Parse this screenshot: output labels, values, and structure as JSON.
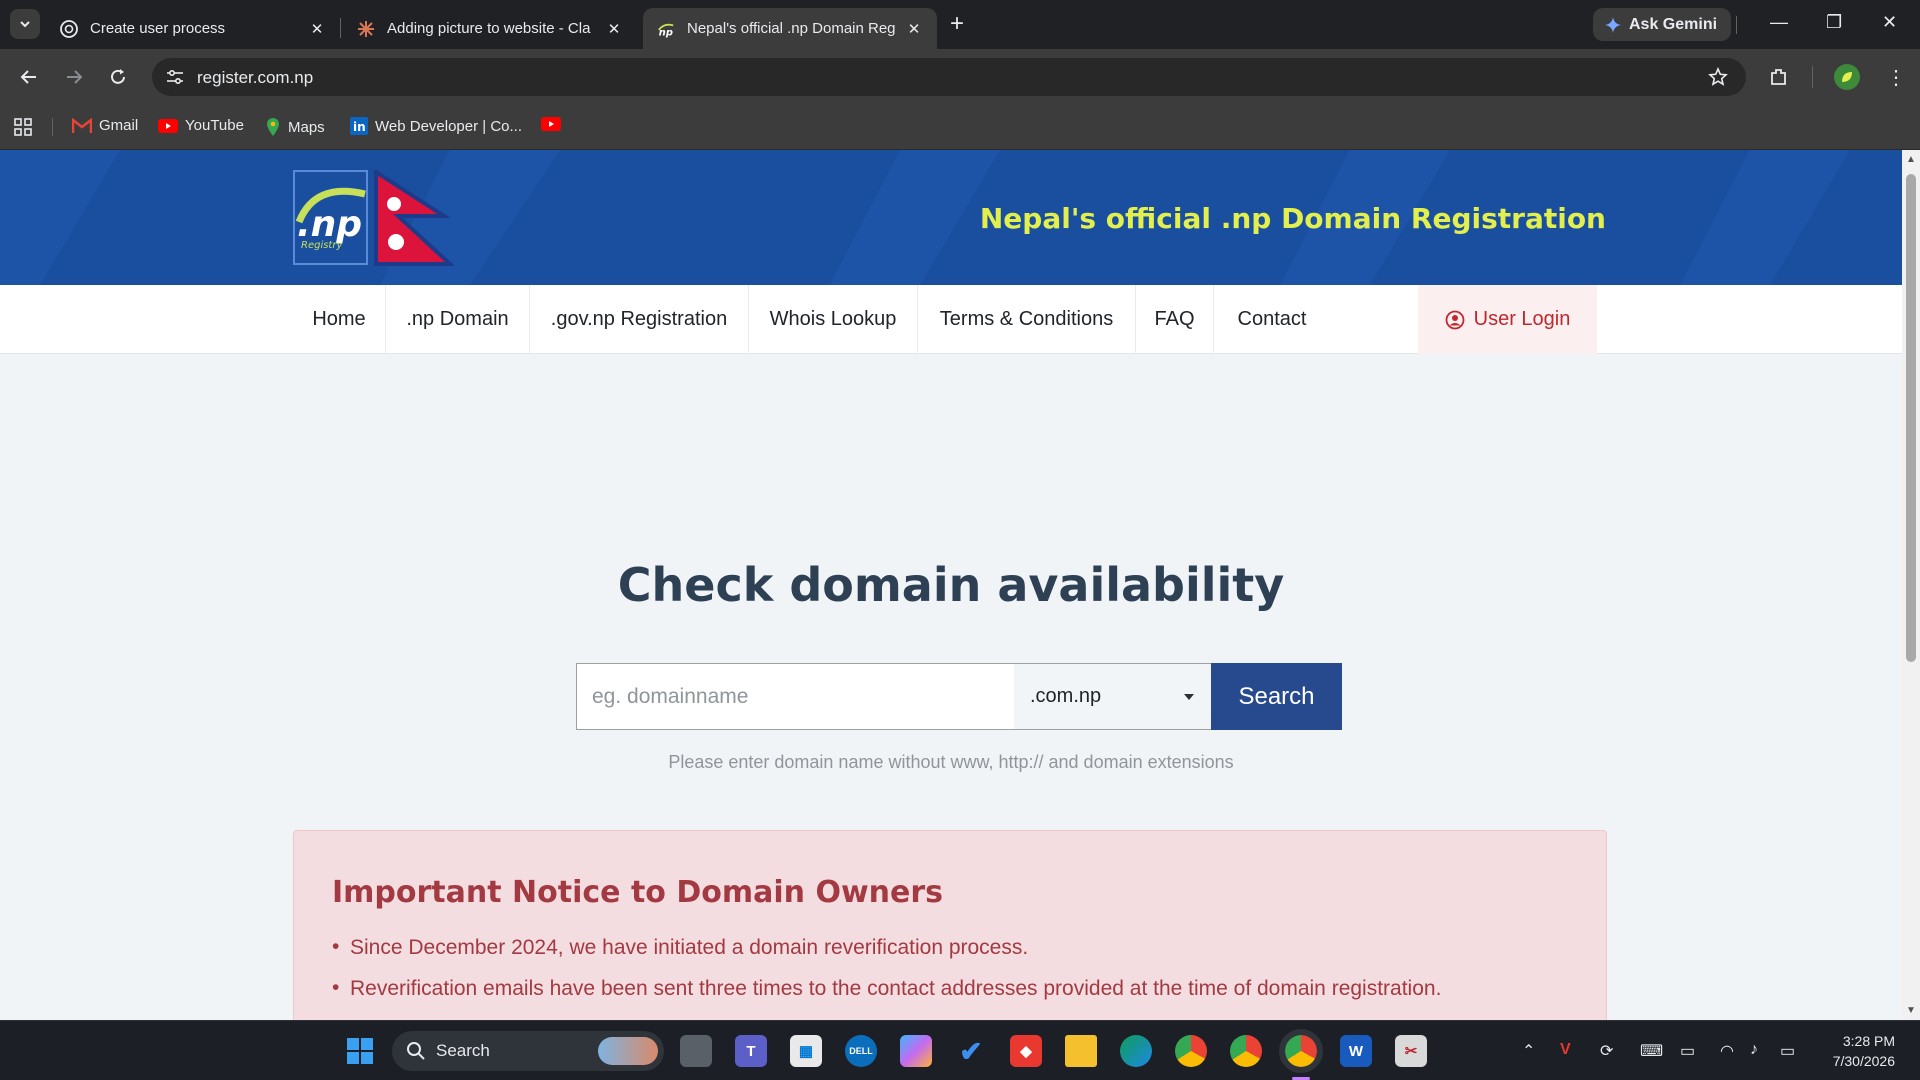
{
  "browser": {
    "tabs": [
      {
        "title": "Create user process",
        "icon": "openai-icon",
        "active": false
      },
      {
        "title": "Adding picture to website - Cla",
        "icon": "claude-icon",
        "active": false
      },
      {
        "title": "Nepal's official .np Domain Reg",
        "icon": "np-registry-icon",
        "active": true
      }
    ],
    "ask_gemini_label": "Ask Gemini",
    "url": "register.com.np",
    "bookmarks": [
      {
        "label": "Gmail",
        "icon": "gmail-icon"
      },
      {
        "label": "YouTube",
        "icon": "youtube-icon"
      },
      {
        "label": "Maps",
        "icon": "maps-icon"
      },
      {
        "label": "Web Developer | Co...",
        "icon": "linkedin-icon"
      },
      {
        "label": "",
        "icon": "youtube-icon"
      }
    ]
  },
  "site": {
    "logo_text": ".np",
    "logo_sub": "Registry",
    "tagline": "Nepal's official .np Domain Registration",
    "nav": [
      {
        "label": "Home"
      },
      {
        "label": ".np Domain"
      },
      {
        "label": ".gov.np Registration"
      },
      {
        "label": "Whois Lookup"
      },
      {
        "label": "Terms & Conditions"
      },
      {
        "label": "FAQ"
      },
      {
        "label": "Contact"
      }
    ],
    "login_label": "User Login",
    "hero_title": "Check domain availability",
    "search": {
      "placeholder": "eg. domainname",
      "value": "",
      "tld_selected": ".com.np",
      "button_label": "Search",
      "hint": "Please enter domain name without www, http:// and domain extensions"
    },
    "notice": {
      "title": "Important Notice to Domain Owners",
      "items": [
        "Since December 2024, we have initiated a domain reverification process.",
        "Reverification emails have been sent three times to the contact addresses provided at the time of domain registration."
      ]
    }
  },
  "taskbar": {
    "search_label": "Search",
    "time": "3:28 PM",
    "date": "7/30/2026"
  },
  "colors": {
    "header_blue": "#1a4fa0",
    "tagline_yellow": "#e2ef4c",
    "search_button": "#27498d",
    "notice_text": "#a33a42",
    "notice_bg": "#f3dde0",
    "login_red": "#c0282f"
  }
}
